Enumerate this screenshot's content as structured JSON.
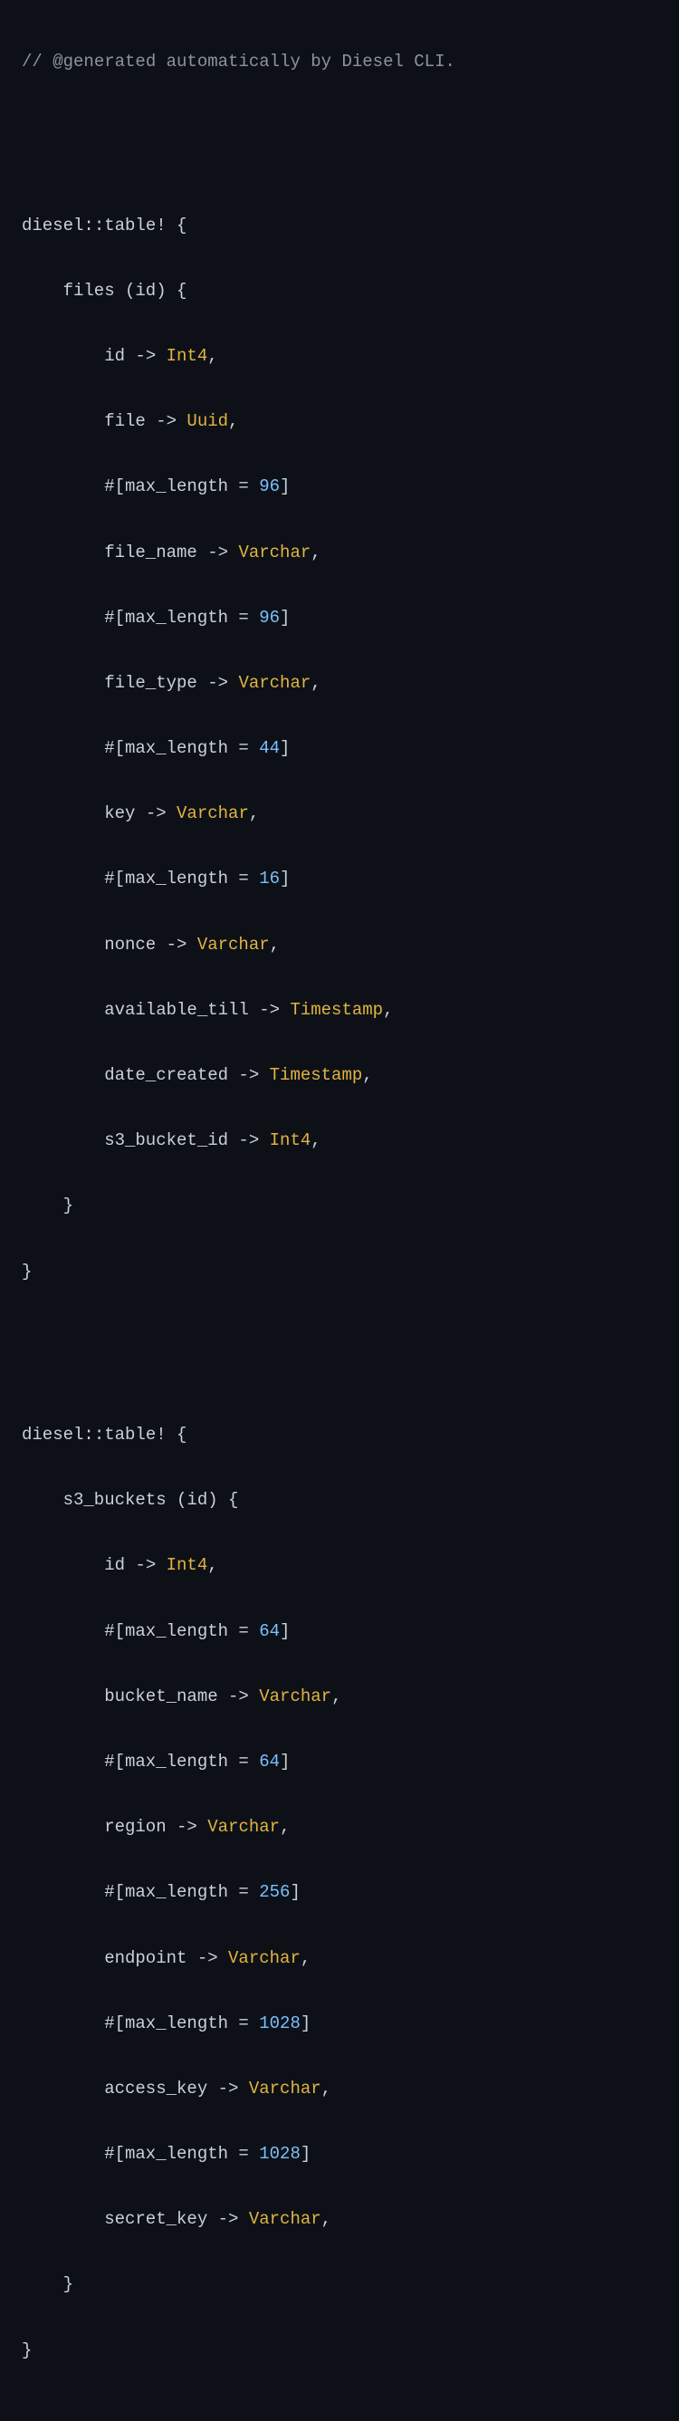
{
  "comment": "// @generated automatically by Diesel CLI.",
  "macro": "diesel::table!",
  "tables": {
    "files": {
      "header": "files (id) {",
      "arrow": " -> ",
      "comma": ",",
      "close1": "}",
      "close2": "}",
      "attr_prefix": "#[max_length = ",
      "attr_suffix": "]",
      "fields": {
        "id": {
          "name": "id",
          "type": "Int4"
        },
        "file": {
          "name": "file",
          "type": "Uuid"
        },
        "file_name_len": {
          "len": "96"
        },
        "file_name": {
          "name": "file_name",
          "type": "Varchar"
        },
        "file_type_len": {
          "len": "96"
        },
        "file_type": {
          "name": "file_type",
          "type": "Varchar"
        },
        "key_len": {
          "len": "44"
        },
        "key": {
          "name": "key",
          "type": "Varchar"
        },
        "nonce_len": {
          "len": "16"
        },
        "nonce": {
          "name": "nonce",
          "type": "Varchar"
        },
        "available_till": {
          "name": "available_till",
          "type": "Timestamp"
        },
        "date_created": {
          "name": "date_created",
          "type": "Timestamp"
        },
        "s3_bucket_id": {
          "name": "s3_bucket_id",
          "type": "Int4"
        }
      }
    },
    "s3_buckets": {
      "header": "s3_buckets (id) {",
      "arrow": " -> ",
      "comma": ",",
      "close1": "}",
      "close2": "}",
      "attr_prefix": "#[max_length = ",
      "attr_suffix": "]",
      "fields": {
        "id": {
          "name": "id",
          "type": "Int4"
        },
        "bucket_name_len": {
          "len": "64"
        },
        "bucket_name": {
          "name": "bucket_name",
          "type": "Varchar"
        },
        "region_len": {
          "len": "64"
        },
        "region": {
          "name": "region",
          "type": "Varchar"
        },
        "endpoint_len": {
          "len": "256"
        },
        "endpoint": {
          "name": "endpoint",
          "type": "Varchar"
        },
        "access_key_len": {
          "len": "1028"
        },
        "access_key": {
          "name": "access_key",
          "type": "Varchar"
        },
        "secret_key_len": {
          "len": "1028"
        },
        "secret_key": {
          "name": "secret_key",
          "type": "Varchar"
        }
      }
    }
  },
  "brace_open": " {"
}
